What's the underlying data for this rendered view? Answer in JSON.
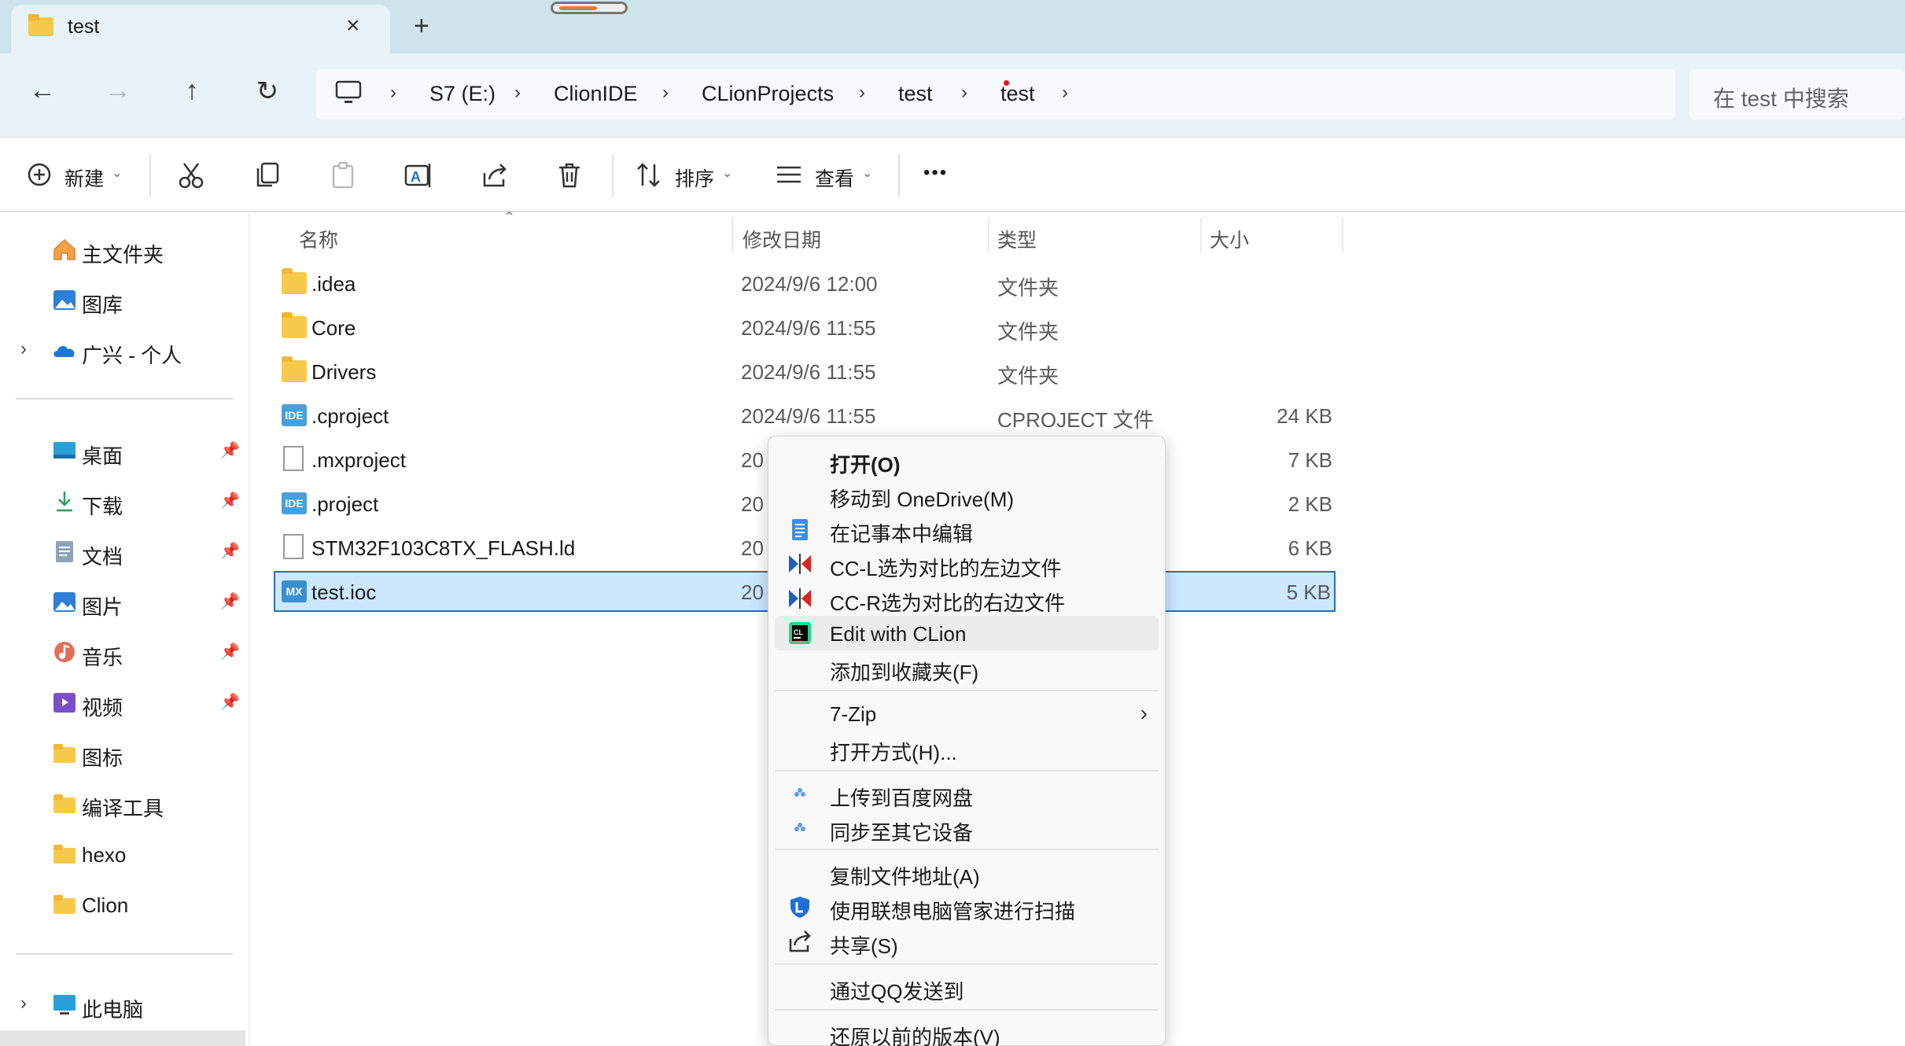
{
  "window": {
    "tab_title": "test",
    "tab_close_icon": "×",
    "new_tab_icon": "+"
  },
  "nav": {
    "back": "←",
    "forward": "→",
    "up": "↑",
    "refresh": "↻"
  },
  "breadcrumb": {
    "items": [
      "S7 (E:)",
      "ClionIDE",
      "CLionProjects",
      "test",
      "test"
    ],
    "separator": "›"
  },
  "search": {
    "placeholder": "在 test 中搜索"
  },
  "toolbar": {
    "new_label": "新建",
    "sort_label": "排序",
    "view_label": "查看",
    "more_label": "•••"
  },
  "sidebar": {
    "top_items": [
      {
        "label": "主文件夹",
        "icon": "home-icon"
      },
      {
        "label": "图库",
        "icon": "gallery-icon"
      },
      {
        "label": "广兴 - 个人",
        "icon": "onedrive-icon"
      }
    ],
    "quick_access": [
      {
        "label": "桌面",
        "icon": "desktop-icon",
        "pinned": true
      },
      {
        "label": "下载",
        "icon": "download-icon",
        "pinned": true
      },
      {
        "label": "文档",
        "icon": "documents-icon",
        "pinned": true
      },
      {
        "label": "图片",
        "icon": "pictures-icon",
        "pinned": true
      },
      {
        "label": "音乐",
        "icon": "music-icon",
        "pinned": true
      },
      {
        "label": "视频",
        "icon": "videos-icon",
        "pinned": true
      },
      {
        "label": "图标",
        "icon": "folder-icon",
        "pinned": false
      },
      {
        "label": "编译工具",
        "icon": "folder-icon",
        "pinned": false
      },
      {
        "label": "hexo",
        "icon": "folder-icon",
        "pinned": false
      },
      {
        "label": "Clion",
        "icon": "folder-icon",
        "pinned": false
      }
    ],
    "this_pc": {
      "label": "此电脑",
      "icon": "pc-icon"
    }
  },
  "columns": {
    "name": "名称",
    "modified": "修改日期",
    "type": "类型",
    "size": "大小"
  },
  "files": [
    {
      "name": ".idea",
      "modified": "2024/9/6 12:00",
      "type": "文件夹",
      "size": "",
      "icon": "folder-icon"
    },
    {
      "name": "Core",
      "modified": "2024/9/6 11:55",
      "type": "文件夹",
      "size": "",
      "icon": "folder-icon"
    },
    {
      "name": "Drivers",
      "modified": "2024/9/6 11:55",
      "type": "文件夹",
      "size": "",
      "icon": "folder-icon"
    },
    {
      "name": ".cproject",
      "modified": "2024/9/6 11:55",
      "type": "CPROJECT 文件",
      "size": "24 KB",
      "icon": "ide-file-icon",
      "badge": "IDE"
    },
    {
      "name": ".mxproject",
      "modified": "20",
      "type": "",
      "size": "7 KB",
      "icon": "blank-file-icon"
    },
    {
      "name": ".project",
      "modified": "20",
      "type": "",
      "size": "2 KB",
      "icon": "ide-file-icon",
      "badge": "IDE"
    },
    {
      "name": "STM32F103C8TX_FLASH.ld",
      "modified": "20",
      "type": "",
      "size": "6 KB",
      "icon": "blank-file-icon"
    },
    {
      "name": "test.ioc",
      "modified": "20",
      "type": "",
      "size": "5 KB",
      "icon": "mx-file-icon",
      "badge": "MX",
      "selected": true
    }
  ],
  "context_menu": {
    "groups": [
      [
        {
          "label": "打开(O)",
          "bold": true,
          "icon": ""
        },
        {
          "label": "移动到 OneDrive(M)",
          "icon": ""
        },
        {
          "label": "在记事本中编辑",
          "icon": "notepad-icon"
        },
        {
          "label": "CC-L选为对比的左边文件",
          "icon": "compare-icon"
        },
        {
          "label": "CC-R选为对比的右边文件",
          "icon": "compare-icon"
        },
        {
          "label": "Edit with CLion",
          "icon": "clion-icon",
          "hover": true
        },
        {
          "label": "添加到收藏夹(F)",
          "icon": ""
        }
      ],
      [
        {
          "label": "7-Zip",
          "icon": "",
          "submenu": true
        },
        {
          "label": "打开方式(H)...",
          "icon": ""
        }
      ],
      [
        {
          "label": "上传到百度网盘",
          "icon": "baidu-icon"
        },
        {
          "label": "同步至其它设备",
          "icon": "baidu-icon"
        }
      ],
      [
        {
          "label": "复制文件地址(A)",
          "icon": ""
        },
        {
          "label": "使用联想电脑管家进行扫描",
          "icon": "lenovo-shield-icon"
        },
        {
          "label": "共享(S)",
          "icon": "share-icon"
        }
      ],
      [
        {
          "label": "通过QQ发送到",
          "icon": ""
        }
      ],
      [
        {
          "label": "还原以前的版本(V)",
          "icon": ""
        }
      ]
    ],
    "submenu_arrow": "›"
  },
  "colors": {
    "titlebar": "#cfe3ec",
    "addressbar": "#e9f2f6",
    "selection": "#cce8ff",
    "selection_border": "#2a6db8",
    "folder": "#f7c94b"
  }
}
